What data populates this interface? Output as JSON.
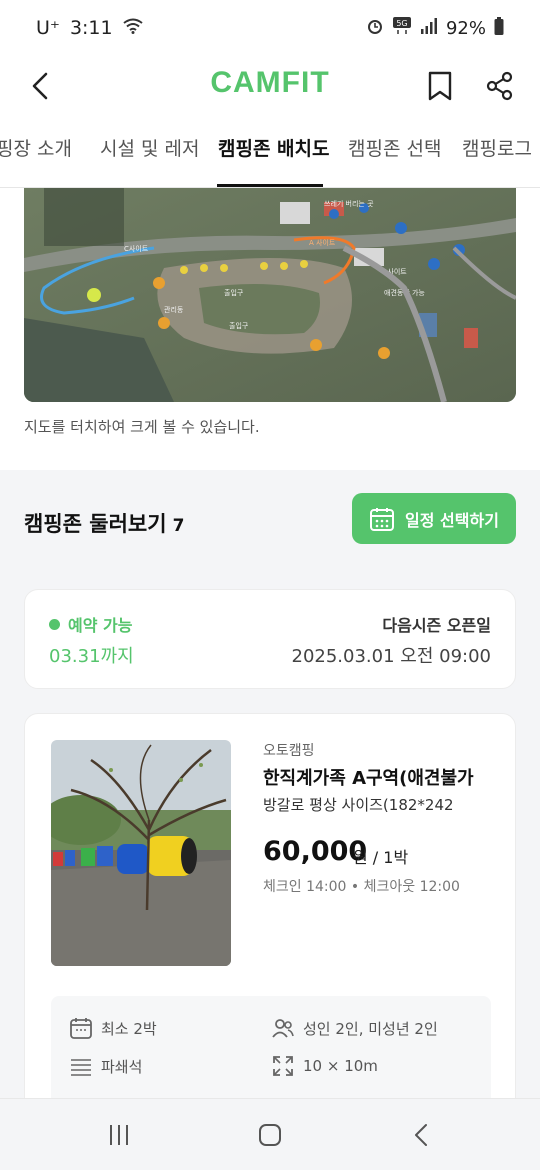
{
  "status_bar": {
    "carrier": "U⁺",
    "time": "3:11",
    "battery": "92%",
    "icons": [
      "wifi-icon",
      "alarm-icon",
      "5g-icon",
      "signal-icon",
      "battery-icon"
    ]
  },
  "header": {
    "logo": "CAMFIT",
    "icons": [
      "back-icon",
      "bookmark-icon",
      "share-icon"
    ]
  },
  "tabs": [
    {
      "label": "캠핑장 소개",
      "visible": "핑장 소개"
    },
    {
      "label": "시설 및 레저"
    },
    {
      "label": "캠핑존 배치도",
      "active": true
    },
    {
      "label": "캠핑존 선택"
    },
    {
      "label": "캠핑로그"
    }
  ],
  "map": {
    "caption": "지도를 터치하여 크게 볼 수 있습니다.",
    "labels": [
      "A사이트",
      "B사이트",
      "C사이트",
      "D사이트",
      "출입구",
      "관리동",
      "애견동반 가능",
      "쓰레기 버리는 곳",
      "이 캠핑장은 세척장"
    ]
  },
  "zone_section": {
    "title": "캠핑존 둘러보기",
    "count": "7",
    "schedule_button": "일정 선택하기"
  },
  "booking": {
    "status": "예약 가능",
    "until": "03.31까지",
    "next_label": "다음시즌 오픈일",
    "next_date": "2025.03.01 오전 09:00"
  },
  "site": {
    "type": "오토캠핑",
    "name": "한직계가족 A구역(애견불가",
    "desc": "방갈로 평상 사이즈(182*242",
    "price": "60,000",
    "unit": "원 / 1박",
    "time": "체크인 14:00 • 체크아웃 12:00",
    "info": {
      "min_nights": "최소 2박",
      "people": "성인 2인, 미성년 2인",
      "floor": "파쇄석",
      "size": "10 × 10m"
    }
  },
  "colors": {
    "brand": "#55c46c"
  }
}
